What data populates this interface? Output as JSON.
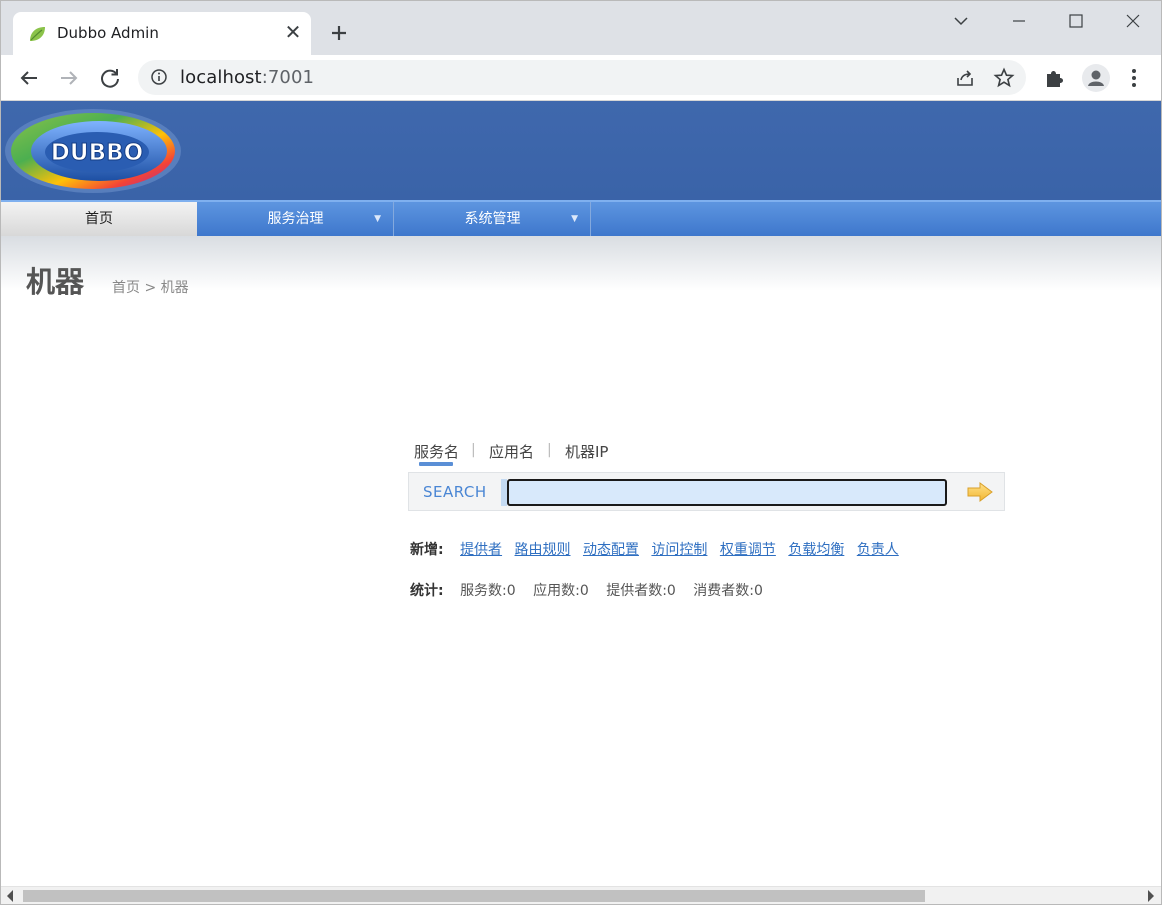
{
  "browser": {
    "tab_title": "Dubbo Admin",
    "url_host": "localhost",
    "url_port": ":7001"
  },
  "app": {
    "logo_text": "DUBBO",
    "nav": [
      {
        "label": "首页",
        "active": true
      },
      {
        "label": "服务治理",
        "dropdown": true
      },
      {
        "label": "系统管理",
        "dropdown": true
      }
    ],
    "page_title": "机器",
    "breadcrumb": "首页 > 机器"
  },
  "search": {
    "tabs": [
      "服务名",
      "应用名",
      "机器IP"
    ],
    "active_tab": "服务名",
    "label": "SEARCH",
    "value": ""
  },
  "create": {
    "label": "新增:",
    "links": [
      "提供者",
      "路由规则",
      "动态配置",
      "访问控制",
      "权重调节",
      "负载均衡",
      "负责人"
    ]
  },
  "stats": {
    "label": "统计:",
    "items": [
      "服务数:0",
      "应用数:0",
      "提供者数:0",
      "消费者数:0"
    ]
  },
  "colors": {
    "banner": "#3f68ad",
    "nav": "#4a82d4",
    "link": "#2f6fc1"
  }
}
